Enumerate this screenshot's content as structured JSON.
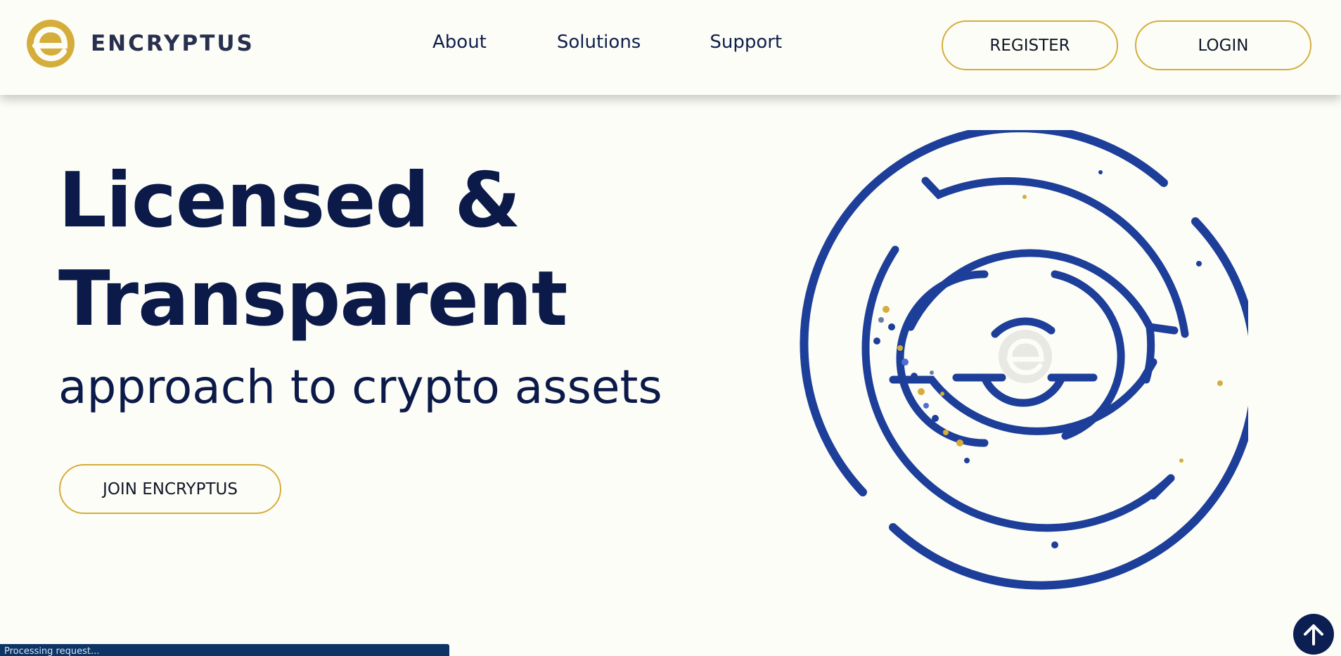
{
  "header": {
    "brand": "ENCRYPTUS",
    "nav": [
      {
        "label": "About"
      },
      {
        "label": "Solutions"
      },
      {
        "label": "Support"
      }
    ],
    "register_label": "REGISTER",
    "login_label": "LOGIN"
  },
  "hero": {
    "title_line1": "Licensed &",
    "title_line2": "Transparent",
    "subtitle": "approach to crypto assets",
    "cta_label": "JOIN ENCRYPTUS"
  },
  "status": {
    "text": "Processing request..."
  },
  "icons": {
    "logo": "encryptus-logo-icon",
    "maze": "maze-illustration",
    "scroll_top": "arrow-up-icon"
  },
  "colors": {
    "background": "#fdfdf7",
    "navy": "#0b1a49",
    "gold": "#d4ad3b",
    "maze_blue": "#1d3f9a",
    "status_bar": "#0c3566"
  }
}
